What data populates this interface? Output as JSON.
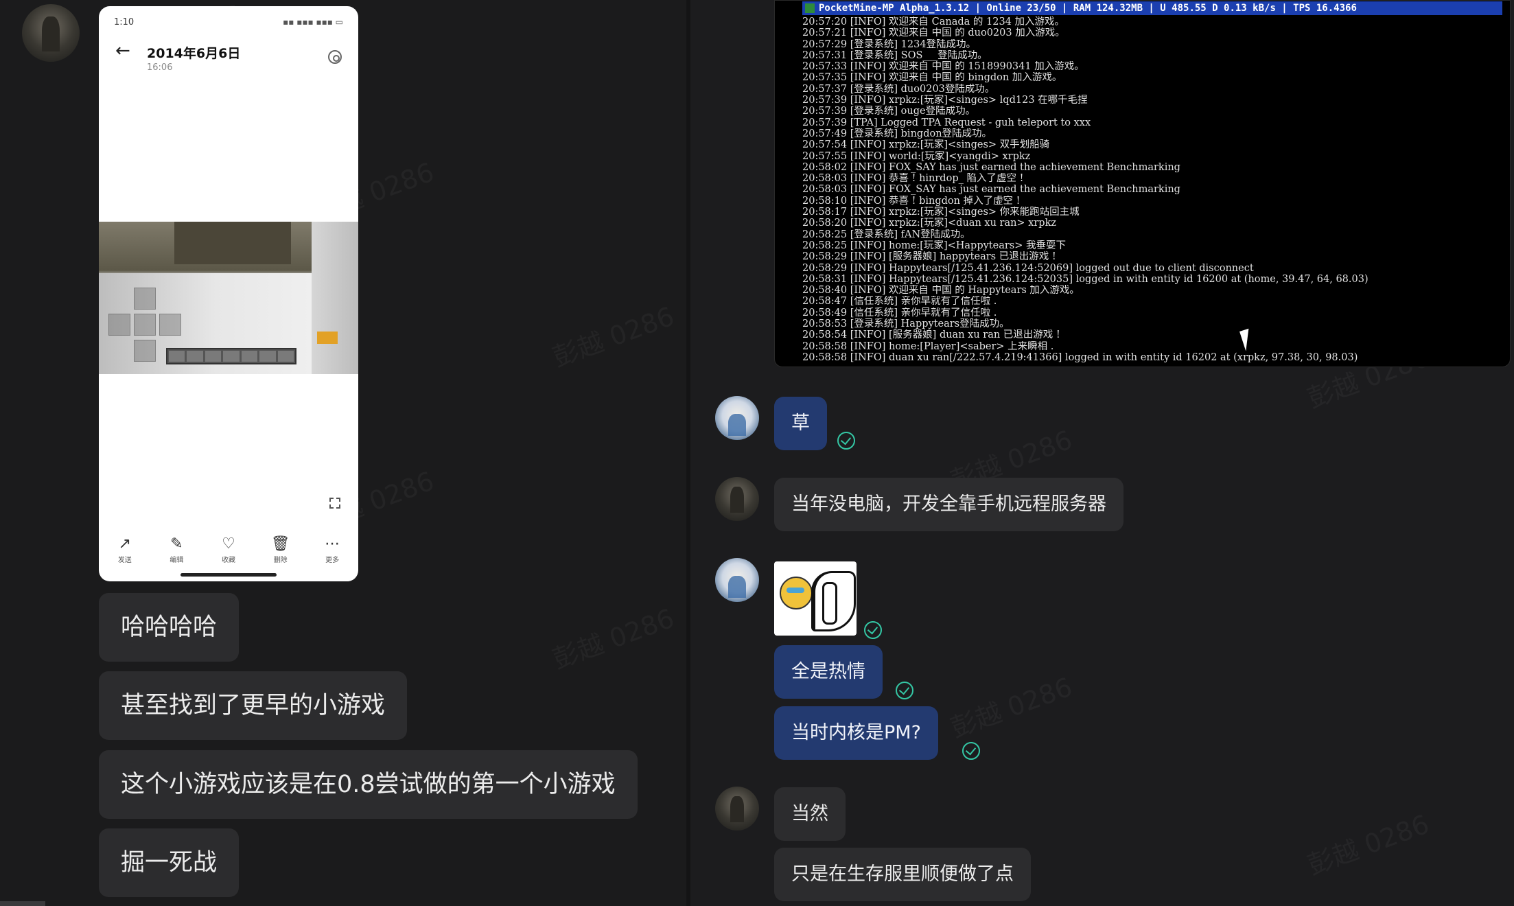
{
  "watermark": "彭越 0286",
  "left_chat": {
    "phone": {
      "status_time": "1:10",
      "status_right": "▪▪ ▪▪▪ ▪▪▪ ▭",
      "title": "2014年6月6日",
      "time": "16:06",
      "actions": [
        {
          "icon": "share-icon",
          "glyph": "↗",
          "label": "发送"
        },
        {
          "icon": "edit-icon",
          "glyph": "✎",
          "label": "编辑"
        },
        {
          "icon": "heart-icon",
          "glyph": "♡",
          "label": "收藏"
        },
        {
          "icon": "trash-icon",
          "glyph": "🗑",
          "label": "删除"
        },
        {
          "icon": "more-icon",
          "glyph": "⋯",
          "label": "更多"
        }
      ]
    },
    "messages": [
      "哈哈哈哈",
      "甚至找到了更早的小游戏",
      "这个小游戏应该是在0.8尝试做的第一个小游戏",
      "掘一死战"
    ]
  },
  "terminal": {
    "title": "PocketMine-MP Alpha_1.3.12 | Online 23/50 | RAM 124.32MB | U 485.55 D 0.13 kB/s | TPS 16.4366",
    "lines": [
      "20:57:20 [INFO] 欢迎来自 Canada 的 1234 加入游戏。",
      "20:57:21 [INFO] 欢迎来自 中国 的 duo0203 加入游戏。",
      "20:57:29 [登录系统] 1234登陆成功。",
      "20:57:31 [登录系统] SOS___登陆成功。",
      "20:57:33 [INFO] 欢迎来自 中国 的 1518990341 加入游戏。",
      "20:57:35 [INFO] 欢迎来自 中国 的 bingdon 加入游戏。",
      "20:57:37 [登录系统] duo0203登陆成功。",
      "20:57:39 [INFO] xrpkz:[玩家]<singes> lqd123 在哪千毛捏",
      "20:57:39 [登录系统] ouge登陆成功。",
      "20:57:39 [TPA] Logged TPA Request - guh teleport to xxx",
      "20:57:49 [登录系统] bingdon登陆成功。",
      "20:57:54 [INFO] xrpkz:[玩家]<singes> 双手划船骑",
      "20:57:55 [INFO] world:[玩家]<yangdi> xrpkz",
      "20:58:02 [INFO] FOX_SAY has just earned the achievement Benchmarking",
      "20:58:03 [INFO] 恭喜 ! hinrdop_ 陷入了虚空 !",
      "20:58:03 [INFO] FOX_SAY has just earned the achievement Benchmarking",
      "20:58:10 [INFO] 恭喜 ! bingdon 掉入了虚空 !",
      "20:58:17 [INFO] xrpkz:[玩家]<singes> 你来能跑站回主城",
      "20:58:20 [INFO] xrpkz:[玩家]<duan xu ran> xrpkz",
      "20:58:25 [登录系统] fAN登陆成功。",
      "20:58:25 [INFO] home:[玩家]<Happytears> 我垂耍下",
      "20:58:29 [INFO] [服务器娘] happytears 已退出游戏 !",
      "20:58:29 [INFO] Happytears[/125.41.236.124:52069] logged out due to client disconnect",
      "20:58:31 [INFO] Happytears[/125.41.236.124:52035] logged in with entity id 16200 at (home, 39.47, 64, 68.03)",
      "20:58:40 [INFO] 欢迎来自 中国 的 Happytears 加入游戏。",
      "20:58:47 [信任系统] 亲你早就有了信任啦 .",
      "20:58:49 [信任系统] 亲你早就有了信任啦 .",
      "20:58:53 [登录系统] Happytears登陆成功。",
      "20:58:54 [INFO] [服务器娘] duan xu ran 已退出游戏 !",
      "20:58:58 [INFO] home:[Player]<saber> 上来瞬相 .",
      "20:58:58 [INFO] duan xu ran[/222.57.4.219:41366] logged in with entity id 16202 at (xrpkz, 97.38, 30, 98.03)"
    ]
  },
  "right_chat": {
    "messages": [
      {
        "text": "草",
        "side": "blue"
      },
      {
        "text": "当年没电脑，开发全靠手机远程服务器",
        "side": "gray"
      },
      {
        "text": "全是热情",
        "side": "blue"
      },
      {
        "text": "当时内核是PM?",
        "side": "blue"
      },
      {
        "text": "当然",
        "side": "gray"
      },
      {
        "text": "只是在生存服里顺便做了点",
        "side": "gray"
      }
    ]
  },
  "colors": {
    "background": "#1c1c1d",
    "bubble_gray": "#2c2c2e",
    "bubble_blue": "#233a70",
    "read_tick": "#34c7a5",
    "terminal_title": "#1b3fb0"
  }
}
